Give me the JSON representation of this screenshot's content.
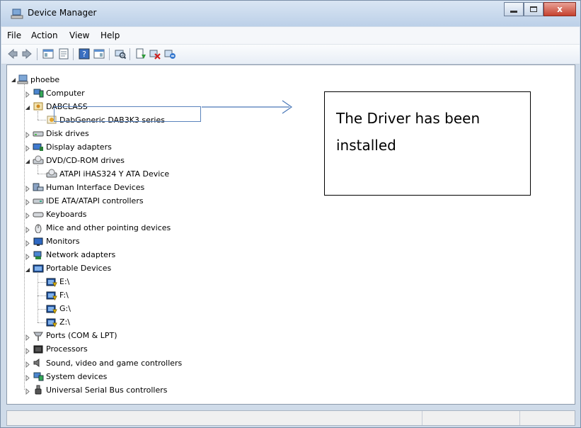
{
  "window": {
    "title": "Device Manager",
    "close_glyph": "x"
  },
  "menu": [
    "File",
    "Action",
    "View",
    "Help"
  ],
  "toolbar": [
    "back-icon",
    "forward-icon",
    "show-hide-console-tree-icon",
    "properties-icon",
    "help-icon",
    "action-pane-icon",
    "scan-hardware-icon",
    "update-driver-icon",
    "disable-device-icon",
    "uninstall-device-icon"
  ],
  "tree": {
    "root": "phoebe",
    "items": [
      {
        "label": "Computer",
        "state": "collapsed",
        "icon": "computer-icon"
      },
      {
        "label": "DABCLASS",
        "state": "expanded",
        "icon": "device-class-icon",
        "children": [
          "DabGeneric DAB3K3 series"
        ]
      },
      {
        "label": "Disk drives",
        "state": "collapsed",
        "icon": "disk-drive-icon"
      },
      {
        "label": "Display adapters",
        "state": "collapsed",
        "icon": "display-adapter-icon"
      },
      {
        "label": "DVD/CD-ROM drives",
        "state": "expanded",
        "icon": "dvd-drive-icon",
        "children": [
          "ATAPI iHAS324   Y ATA Device"
        ]
      },
      {
        "label": "Human Interface Devices",
        "state": "collapsed",
        "icon": "hid-icon"
      },
      {
        "label": "IDE ATA/ATAPI controllers",
        "state": "collapsed",
        "icon": "ide-controller-icon"
      },
      {
        "label": "Keyboards",
        "state": "collapsed",
        "icon": "keyboard-icon"
      },
      {
        "label": "Mice and other pointing devices",
        "state": "collapsed",
        "icon": "mouse-icon"
      },
      {
        "label": "Monitors",
        "state": "collapsed",
        "icon": "monitor-icon"
      },
      {
        "label": "Network adapters",
        "state": "collapsed",
        "icon": "network-adapter-icon"
      },
      {
        "label": "Portable Devices",
        "state": "expanded",
        "icon": "portable-device-icon",
        "children": [
          "E:\\",
          "F:\\",
          "G:\\",
          "Z:\\"
        ]
      },
      {
        "label": "Ports (COM & LPT)",
        "state": "collapsed",
        "icon": "port-icon"
      },
      {
        "label": "Processors",
        "state": "collapsed",
        "icon": "processor-icon"
      },
      {
        "label": "Sound, video and game controllers",
        "state": "collapsed",
        "icon": "sound-icon"
      },
      {
        "label": "System devices",
        "state": "collapsed",
        "icon": "system-devices-icon"
      },
      {
        "label": "Universal Serial Bus controllers",
        "state": "collapsed",
        "icon": "usb-icon"
      }
    ]
  },
  "callout": {
    "line1": "The Driver has been",
    "line2": "installed"
  },
  "colors": {
    "accent": "#3c78c6",
    "titlebar": "#c9d9ee",
    "close": "#c5412e"
  }
}
